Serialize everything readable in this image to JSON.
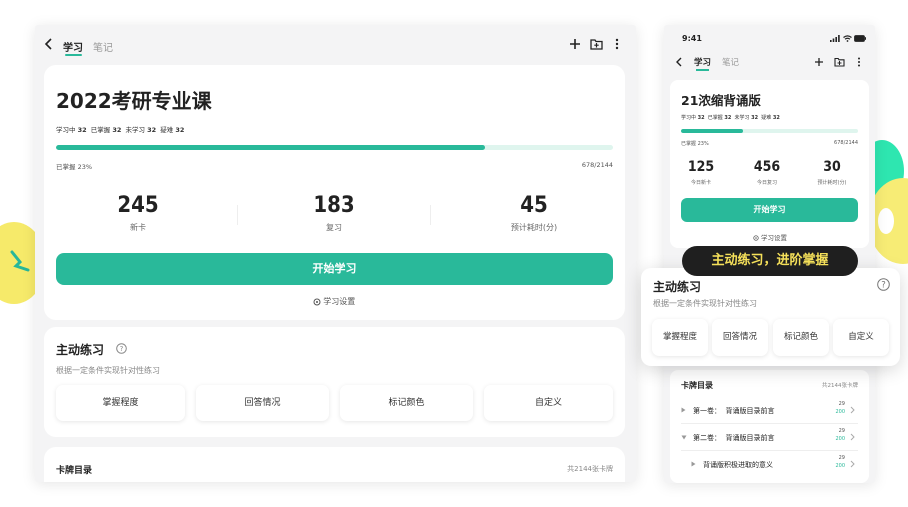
{
  "tablet": {
    "tabs": [
      {
        "label": "学习"
      },
      {
        "label": "笔记"
      }
    ],
    "deck": {
      "title": "2022考研专业课",
      "stats": [
        {
          "label": "学习中",
          "value": "32"
        },
        {
          "label": "已掌握",
          "value": "32"
        },
        {
          "label": "未学习",
          "value": "32"
        },
        {
          "label": "疑难",
          "value": "32"
        }
      ],
      "mastered_label": "已掌握 23%",
      "progress_count": "678/2144",
      "progress_fraction": 0.77,
      "metrics": [
        {
          "value": "245",
          "label": "新卡"
        },
        {
          "value": "183",
          "label": "复习"
        },
        {
          "value": "45",
          "label": "预计耗时(分)"
        }
      ],
      "start_button": "开始学习",
      "settings_label": "学习设置"
    },
    "practice": {
      "title": "主动练习",
      "subtitle": "根据一定条件实现针对性练习",
      "options": [
        "掌握程度",
        "回答情况",
        "标记颜色",
        "自定义"
      ]
    },
    "catalog": {
      "title": "卡牌目录",
      "count": "共2144张卡牌"
    }
  },
  "phone": {
    "status_time": "9:41",
    "tabs": [
      {
        "label": "学习"
      },
      {
        "label": "笔记"
      }
    ],
    "deck": {
      "title": "21浓缩背诵版",
      "stats": [
        {
          "label": "学习中",
          "value": "32"
        },
        {
          "label": "已掌握",
          "value": "32"
        },
        {
          "label": "未学习",
          "value": "32"
        },
        {
          "label": "疑难",
          "value": "32"
        }
      ],
      "mastered_label": "已掌握 23%",
      "progress_count": "678/2144",
      "progress_fraction": 0.35,
      "metrics": [
        {
          "value": "125",
          "label": "今日新卡"
        },
        {
          "value": "456",
          "label": "今日复习"
        },
        {
          "value": "30",
          "label": "预计耗时(分)"
        }
      ],
      "start_button": "开始学习",
      "settings_label": "学习设置"
    },
    "catalog": {
      "title": "卡牌目录",
      "count": "共2144张卡牌",
      "items": [
        {
          "label": "第一卷：  背诵版目录前言",
          "top": "29",
          "bottom": "200"
        },
        {
          "label": "第二卷：  背诵版目录前言",
          "top": "29",
          "bottom": "200"
        },
        {
          "label": "背诵版积极进取的意义",
          "top": "29",
          "bottom": "200"
        }
      ]
    }
  },
  "overlay": {
    "pill": "主动练习，进阶掌握",
    "title": "主动练习",
    "subtitle": "根据一定条件实现针对性练习",
    "options": [
      "掌握程度",
      "回答情况",
      "标记颜色",
      "自定义"
    ]
  },
  "colors": {
    "accent": "#29b99a",
    "progress_track": "#dff5ee",
    "pill_bg": "#1f1f1f",
    "pill_text": "#f5e05a"
  }
}
